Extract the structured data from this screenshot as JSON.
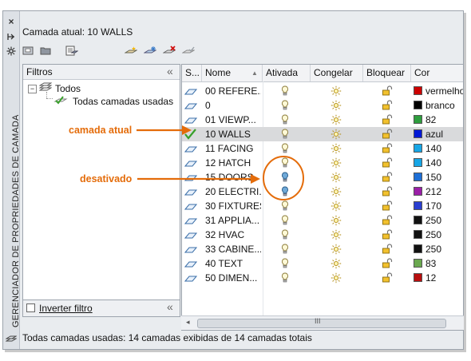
{
  "palette": {
    "title_vertical": "GERENCIADOR DE PROPRIEDADES DE CAMADA",
    "current_layer": "Camada atual: 10 WALLS"
  },
  "filters": {
    "header": "Filtros",
    "tree_root": "Todos",
    "tree_child": "Todas camadas usadas",
    "invert_label": "Inverter filtro",
    "collapse_glyph": "«"
  },
  "columns": [
    "S...",
    "Nome",
    "Ativada",
    "Congelar",
    "Bloquear",
    "Cor"
  ],
  "layers": [
    {
      "name": "00 REFERE...",
      "on": true,
      "color": "#cc0000",
      "color_name": "vermelho",
      "current": false
    },
    {
      "name": "0",
      "on": true,
      "color": "#000000",
      "color_name": "branco",
      "current": false
    },
    {
      "name": "01 VIEWP...",
      "on": true,
      "color": "#2e9e3e",
      "color_name": "82",
      "current": false
    },
    {
      "name": "10 WALLS",
      "on": true,
      "color": "#0018d6",
      "color_name": "azul",
      "current": true
    },
    {
      "name": "11 FACING",
      "on": true,
      "color": "#17a6e6",
      "color_name": "140",
      "current": false
    },
    {
      "name": "12 HATCH",
      "on": true,
      "color": "#17a6e6",
      "color_name": "140",
      "current": false
    },
    {
      "name": "15 DOORS",
      "on": false,
      "color": "#1e6fd6",
      "color_name": "150",
      "current": false
    },
    {
      "name": "20 ELECTRI...",
      "on": false,
      "color": "#9b1fa8",
      "color_name": "212",
      "current": false
    },
    {
      "name": "30 FIXTURES",
      "on": true,
      "color": "#2a3fd1",
      "color_name": "170",
      "current": false
    },
    {
      "name": "31 APPLIA...",
      "on": true,
      "color": "#111111",
      "color_name": "250",
      "current": false
    },
    {
      "name": "32 HVAC",
      "on": true,
      "color": "#111111",
      "color_name": "250",
      "current": false
    },
    {
      "name": "33 CABINE...",
      "on": true,
      "color": "#111111",
      "color_name": "250",
      "current": false
    },
    {
      "name": "40 TEXT",
      "on": true,
      "color": "#6aa84f",
      "color_name": "83",
      "current": false
    },
    {
      "name": "50 DIMEN...",
      "on": true,
      "color": "#b80f0f",
      "color_name": "12",
      "current": false
    }
  ],
  "annotations": {
    "current": "camada atual",
    "off": "desativado"
  },
  "status_text": "Todas camadas usadas: 14 camadas exibidas de 14 camadas totais",
  "scrollbar_grip": "III",
  "colors": {
    "accent_orange": "#e46c0a",
    "selection": "#d9dadc"
  },
  "icons": {
    "close": "×",
    "autohide": "pin-icon",
    "properties": "gear-icon"
  }
}
